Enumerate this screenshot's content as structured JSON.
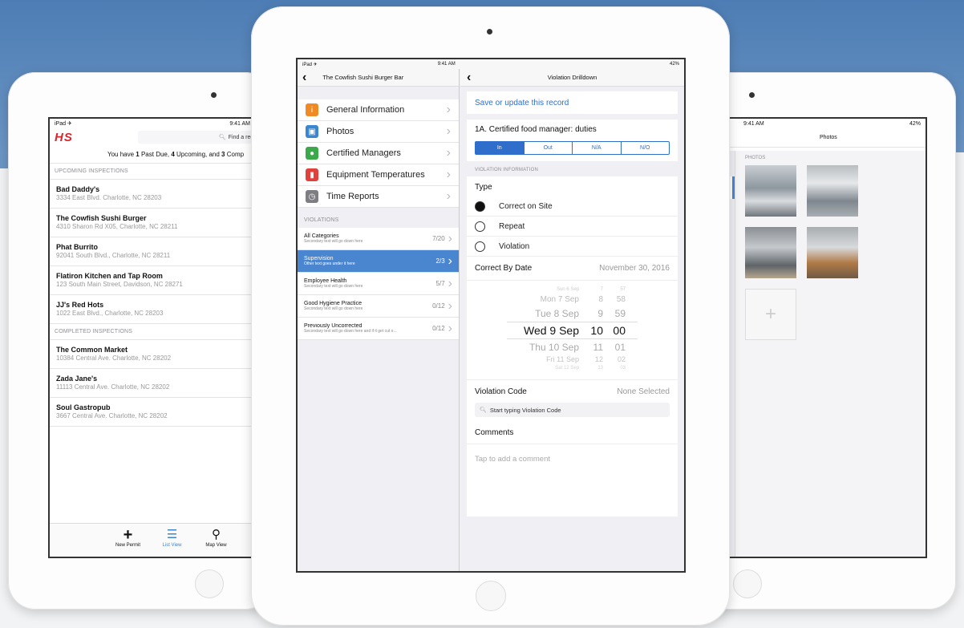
{
  "left": {
    "status_carrier": "iPad ✈",
    "status_time": "9:41 AM",
    "logo": "HS",
    "search_placeholder": "Find a record",
    "summary_prefix": "You have ",
    "summary_past_due": "1",
    "summary_mid1": " Past Due, ",
    "summary_upcoming": "4",
    "summary_mid2": " Upcoming, and ",
    "summary_completed": "3",
    "summary_suffix": " Comp",
    "upcoming_header": "UPCOMING INSPECTIONS",
    "upcoming": [
      {
        "name": "Bad Daddy's",
        "address": "3334 East Blvd. Charlotte, NC 28203"
      },
      {
        "name": "The Cowfish Sushi Burger",
        "address": "4310 Sharon Rd X05, Charlotte, NC 28211"
      },
      {
        "name": "Phat Burrito",
        "address": "92041 South Blvd., Charlotte, NC 28211"
      },
      {
        "name": "Flatiron Kitchen and Tap Room",
        "address": "123 South Main Street, Davidson, NC 28271"
      },
      {
        "name": "JJ's Red Hots",
        "address": "1022 East Blvd., Charlotte, NC 28203"
      }
    ],
    "completed_header": "COMPLETED INSPECTIONS",
    "completed": [
      {
        "name": "The Common Market",
        "address": "10384 Central Ave. Charlotte, NC 28202"
      },
      {
        "name": "Zada Jane's",
        "address": "11113 Central Ave. Charlotte, NC 28202"
      },
      {
        "name": "Soul Gastropub",
        "address": "3667 Central Ave. Charlotte, NC 28202"
      }
    ],
    "tabs": [
      {
        "label": "New Permit",
        "icon": "plus-icon"
      },
      {
        "label": "List View",
        "icon": "list-icon"
      },
      {
        "label": "Map View",
        "icon": "map-pin-icon"
      }
    ]
  },
  "center": {
    "status_carrier": "iPad ✈",
    "status_time": "9:41 AM",
    "status_battery": "42%",
    "master_title": "The Cowfish Sushi Burger Bar",
    "menu": [
      {
        "label": "General Information",
        "icon": "info-icon",
        "color": "#f08a24"
      },
      {
        "label": "Photos",
        "icon": "photo-icon",
        "color": "#3a86d1"
      },
      {
        "label": "Certified Managers",
        "icon": "person-icon",
        "color": "#3ba94a"
      },
      {
        "label": "Equipment Temperatures",
        "icon": "thermometer-icon",
        "color": "#e0413b"
      },
      {
        "label": "Time Reports",
        "icon": "clock-icon",
        "color": "#7d7d82"
      }
    ],
    "violations_header": "VIOLATIONS",
    "violations": [
      {
        "title": "All Categories",
        "sub": "Secondary text will go down here",
        "count": "7/20"
      },
      {
        "title": "Supervision",
        "sub": "Other text goes under it here",
        "count": "2/3"
      },
      {
        "title": "Employee Health",
        "sub": "Secondary text will go down here",
        "count": "5/7"
      },
      {
        "title": "Good Hygiene Practice",
        "sub": "Secondary text will go down here",
        "count": "0/12"
      },
      {
        "title": "Previously Uncorrected",
        "sub": "Secondary text will go down here and if it get cut o...",
        "count": "0/12"
      }
    ],
    "detail_title": "Violation Drilldown",
    "save_link": "Save or update this record",
    "item_title": "1A. Certified food manager: duties",
    "segments": [
      "In",
      "Out",
      "N/A",
      "N/O"
    ],
    "section_header": "VIOLATION INFORMATION",
    "type_label": "Type",
    "type_options": [
      "Correct on Site",
      "Repeat",
      "Violation"
    ],
    "correct_by_label": "Correct By Date",
    "correct_by_value": "November 30, 2016",
    "picker": [
      {
        "day": "Sun 6 Sep",
        "h": "7",
        "m": "57"
      },
      {
        "day": "Mon 7 Sep",
        "h": "8",
        "m": "58"
      },
      {
        "day": "Tue 8 Sep",
        "h": "9",
        "m": "59"
      },
      {
        "day": "Wed 9 Sep",
        "h": "10",
        "m": "00"
      },
      {
        "day": "Thu 10 Sep",
        "h": "11",
        "m": "01"
      },
      {
        "day": "Fri 11 Sep",
        "h": "12",
        "m": "02"
      },
      {
        "day": "Sat 12 Sep",
        "h": "13",
        "m": "03"
      }
    ],
    "violation_code_label": "Violation Code",
    "violation_code_value": "None Selected",
    "violation_code_placeholder": "Start typing Violation Code",
    "comments_label": "Comments",
    "comments_placeholder": "Tap to add a comment"
  },
  "right": {
    "status_time": "9:41 AM",
    "status_battery": "42%",
    "title": "Photos",
    "section_header": "PHOTOS"
  },
  "colors": {
    "accent": "#2f6fcb",
    "selected_row": "#4a86cf",
    "banner": "#4d7db4",
    "logo_red": "#d8262e",
    "logo_blue": "#1d5fa8"
  }
}
